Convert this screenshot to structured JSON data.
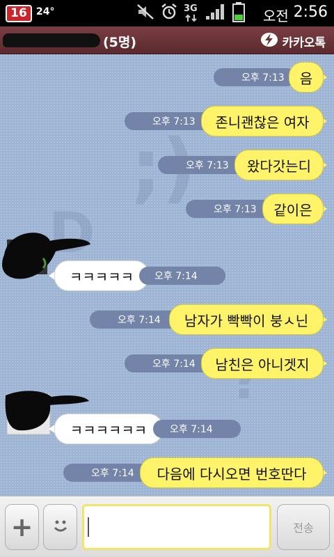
{
  "status_bar": {
    "battery_badge": "16",
    "temperature": "24°",
    "network": "3G",
    "ampm": "오전",
    "time": "2:56",
    "icons": [
      "mute-icon",
      "alarm-icon",
      "network-3g-icon",
      "signal-icon",
      "battery-icon"
    ]
  },
  "title_bar": {
    "member_count": "(5명)",
    "app_name": "카카오톡"
  },
  "messages": [
    {
      "side": "me",
      "text": "음",
      "time": "오후 7:13"
    },
    {
      "side": "me",
      "text": "존니괜찮은 여자",
      "time": "오후 7:13"
    },
    {
      "side": "me",
      "text": "왔다갓는디",
      "time": "오후 7:13"
    },
    {
      "side": "me",
      "text": "같이은",
      "time": "오후 7:13"
    },
    {
      "side": "other",
      "text": "ㅋㅋㅋㅋㅋ",
      "time": "오후 7:14"
    },
    {
      "side": "me",
      "text": "남자가 빡빡이 붕ㅅ닌",
      "time": "오후 7:14"
    },
    {
      "side": "me",
      "text": "남친은 아니겟지",
      "time": "오후 7:14"
    },
    {
      "side": "other",
      "text": "ㅋㅋㅋㅋㅋㅋ",
      "time": "오후 7:14"
    },
    {
      "side": "me",
      "text": "다음에 다시오면 번호딴다",
      "time": "오후 7:14"
    }
  ],
  "input_bar": {
    "plus_label": "+",
    "send_label": "전송",
    "input_value": ""
  },
  "colors": {
    "chat_background": "#9eb4d4",
    "my_bubble": "#fff36a",
    "other_bubble": "#ffffff",
    "title_bar": "#6a3438"
  }
}
